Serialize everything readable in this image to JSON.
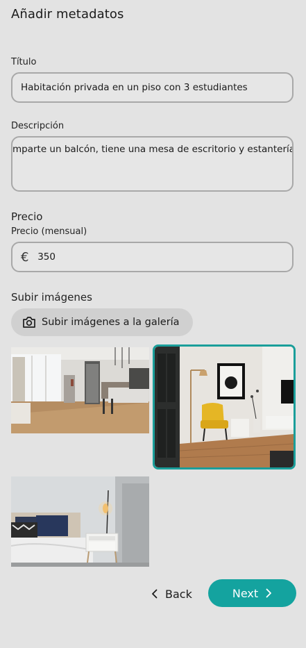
{
  "header": {
    "title": "Añadir metadatos"
  },
  "form": {
    "title_label": "Título",
    "title_value": "Habitación privada en un piso con 3 estudiantes",
    "description_label": "Descripción",
    "description_value": "mparte un balcón, tiene una mesa de escritorio y estanterías.",
    "price_section": "Precio",
    "price_label": "Precio (mensual)",
    "currency_symbol": "€",
    "price_value": "350"
  },
  "images": {
    "section_label": "Subir imágenes",
    "upload_button_label": "Subir imágenes a la galería",
    "selected_border_color": "#1a9e9a",
    "items": [
      {
        "subject": "open-plan living room and kitchen",
        "selected": false
      },
      {
        "subject": "yellow armchair with floor lamp",
        "selected": true
      },
      {
        "subject": "bedroom with bedside lamp",
        "selected": false
      }
    ]
  },
  "nav": {
    "back_label": "Back",
    "next_label": "Next",
    "accent": "#14a39f"
  }
}
